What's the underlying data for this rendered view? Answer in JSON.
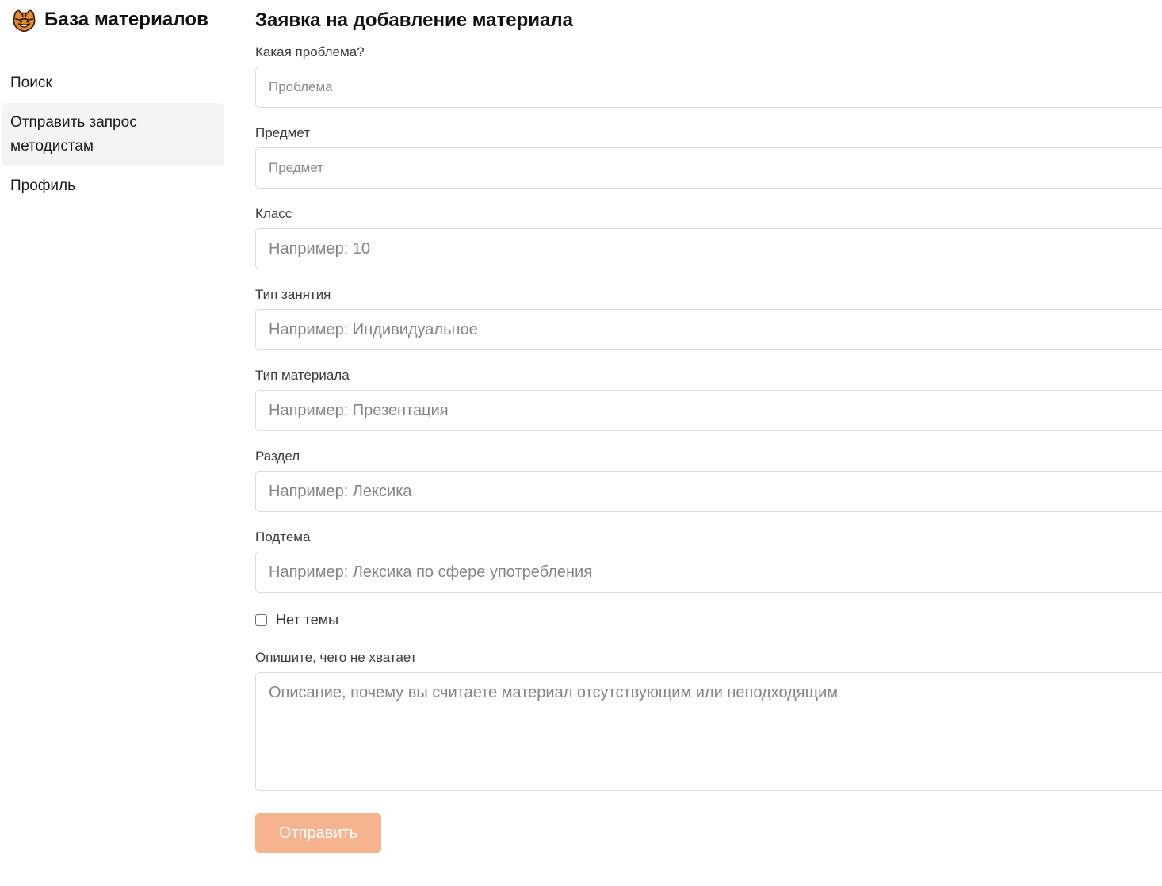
{
  "app": {
    "title": "База материалов",
    "logo_icon": "tiger-logo-icon",
    "accent_color": "#f5b48f"
  },
  "sidebar": {
    "items": [
      {
        "label": "Поиск",
        "active": false
      },
      {
        "label": "Отправить запрос методистам",
        "active": true
      },
      {
        "label": "Профиль",
        "active": false
      }
    ]
  },
  "form": {
    "title": "Заявка на добавление материала",
    "fields": [
      {
        "label": "Какая проблема?",
        "placeholder": "Проблема",
        "value": ""
      },
      {
        "label": "Предмет",
        "placeholder": "Предмет",
        "value": ""
      },
      {
        "label": "Класс",
        "placeholder": "Например: 10",
        "value": ""
      },
      {
        "label": "Тип занятия",
        "placeholder": "Например: Индивидуальное",
        "value": ""
      },
      {
        "label": "Тип материала",
        "placeholder": "Например: Презентация",
        "value": ""
      },
      {
        "label": "Раздел",
        "placeholder": "Например: Лексика",
        "value": ""
      },
      {
        "label": "Подтема",
        "placeholder": "Например: Лексика по сфере употребления",
        "value": ""
      }
    ],
    "no_topic": {
      "label": "Нет темы",
      "checked": false
    },
    "description": {
      "label": "Опишите, чего не хватает",
      "placeholder": "Описание, почему вы считаете материал отсутствующим или неподходящим",
      "value": ""
    },
    "submit_label": "Отправить"
  }
}
